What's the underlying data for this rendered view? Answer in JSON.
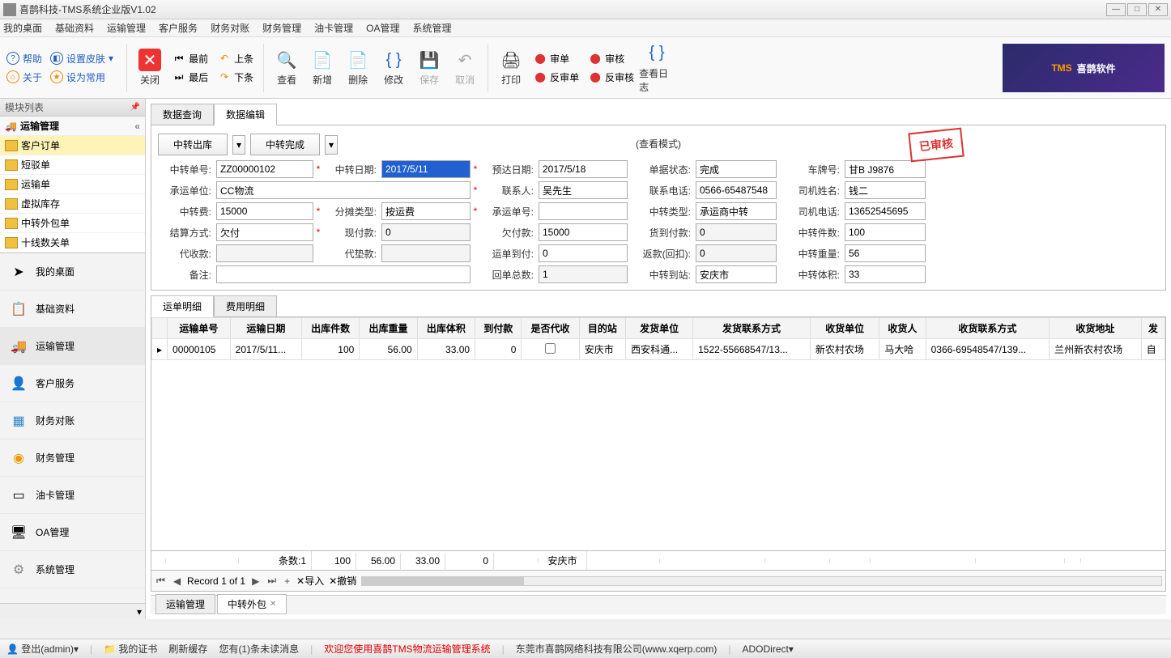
{
  "window": {
    "title": "喜鹊科技-TMS系统企业版V1.02"
  },
  "menu": [
    "我的桌面",
    "基础资料",
    "运输管理",
    "客户服务",
    "财务对账",
    "财务管理",
    "油卡管理",
    "OA管理",
    "系统管理"
  ],
  "toolbar_links": {
    "help": "帮助",
    "skin": "设置皮肤",
    "about": "关于",
    "setdefault": "设为常用"
  },
  "toolbar_pairs": {
    "first": "最前",
    "last": "最后",
    "prev": "上条",
    "next": "下条"
  },
  "toolbar_btns": {
    "close": "关闭",
    "view": "查看",
    "add": "新增",
    "del": "删除",
    "edit": "修改",
    "save": "保存",
    "cancel": "取消",
    "print": "打印",
    "viewlog": "查看日志"
  },
  "toolbar_audit": {
    "audit": "审单",
    "reaudit": "反审单",
    "approve": "审核",
    "reapprove": "反审核"
  },
  "logo": {
    "brand": "TMS",
    "text": "喜鹊软件"
  },
  "sidebar": {
    "title": "模块列表",
    "root": "运输管理",
    "items": [
      "客户订单",
      "短驳单",
      "运输单",
      "虚拟库存",
      "中转外包单",
      "十线数关单"
    ],
    "selected": 0,
    "cats": [
      "我的桌面",
      "基础资料",
      "运输管理",
      "客户服务",
      "财务对账",
      "财务管理",
      "油卡管理",
      "OA管理",
      "系统管理"
    ],
    "selected_cat": 2
  },
  "tabs_top": [
    "数据查询",
    "数据编辑"
  ],
  "action_btns": [
    "中转出库",
    "中转完成"
  ],
  "mode_label": "(查看模式)",
  "stamp": "已审核",
  "form": {
    "labels": {
      "zno": "中转单号:",
      "zdate": "中转日期:",
      "eta": "预达日期:",
      "status": "单据状态:",
      "plate": "车牌号:",
      "carrier": "承运单位:",
      "contact": "联系人:",
      "phone": "联系电话:",
      "driver": "司机姓名:",
      "zfee": "中转费:",
      "alloc": "分摊类型:",
      "cno": "承运单号:",
      "ztype": "中转类型:",
      "dphone": "司机电话:",
      "settle": "结算方式:",
      "cash": "现付款:",
      "credit": "欠付款:",
      "cod": "货到付款:",
      "zcount": "中转件数:",
      "collect": "代收款:",
      "advance": "代垫款:",
      "freightcod": "运单到付:",
      "refund": "返款(回扣):",
      "zweight": "中转重量:",
      "remark": "备注:",
      "returns": "回单总数:",
      "zstation": "中转到站:",
      "zvol": "中转体积:"
    },
    "values": {
      "zno": "ZZ00000102",
      "zdate": "2017/5/11",
      "eta": "2017/5/18",
      "status": "完成",
      "plate": "甘B J9876",
      "carrier": "CC物流",
      "contact": "吴先生",
      "phone": "0566-65487548",
      "driver": "钱二",
      "zfee": "15000",
      "alloc": "按运费",
      "cno": "",
      "ztype": "承运商中转",
      "dphone": "13652545695",
      "settle": "欠付",
      "cash": "0",
      "credit": "15000",
      "cod": "0",
      "zcount": "100",
      "collect": "",
      "advance": "",
      "freightcod": "0",
      "refund": "0",
      "zweight": "56",
      "remark": "",
      "returns": "1",
      "zstation": "安庆市",
      "zvol": "33"
    }
  },
  "detail_tabs": [
    "运单明细",
    "费用明细"
  ],
  "grid": {
    "headers": [
      "运输单号",
      "运输日期",
      "出库件数",
      "出库重量",
      "出库体积",
      "到付款",
      "是否代收",
      "目的站",
      "发货单位",
      "发货联系方式",
      "收货单位",
      "收货人",
      "收货联系方式",
      "收货地址",
      "发"
    ],
    "bold": [
      2,
      3,
      4
    ],
    "rows": [
      [
        "00000105",
        "2017/5/11...",
        "100",
        "56.00",
        "33.00",
        "0",
        "",
        "安庆市",
        "西安科通...",
        "1522-55668547/13...",
        "新农村农场",
        "马大哈",
        "0366-69548547/139...",
        "兰州新农村农场",
        "自"
      ]
    ],
    "summary": {
      "label": "条数:1",
      "c3": "100",
      "c4": "56.00",
      "c5": "33.00",
      "c6": "0",
      "c8": "安庆市"
    }
  },
  "nav": {
    "record": "Record 1 of 1",
    "import": "导入",
    "undo": "撤销"
  },
  "bottom_tabs": [
    {
      "label": "运输管理",
      "closable": false
    },
    {
      "label": "中转外包",
      "closable": true
    }
  ],
  "status": {
    "login": "登出(admin)",
    "cert": "我的证书",
    "refresh": "刷新缓存",
    "msg": "您有(1)条未读消息",
    "welcome": "欢迎您使用喜鹊TMS物流运输管理系统",
    "company": "东莞市喜鹊网络科技有限公司(www.xqerp.com)",
    "ado": "ADODirect"
  }
}
